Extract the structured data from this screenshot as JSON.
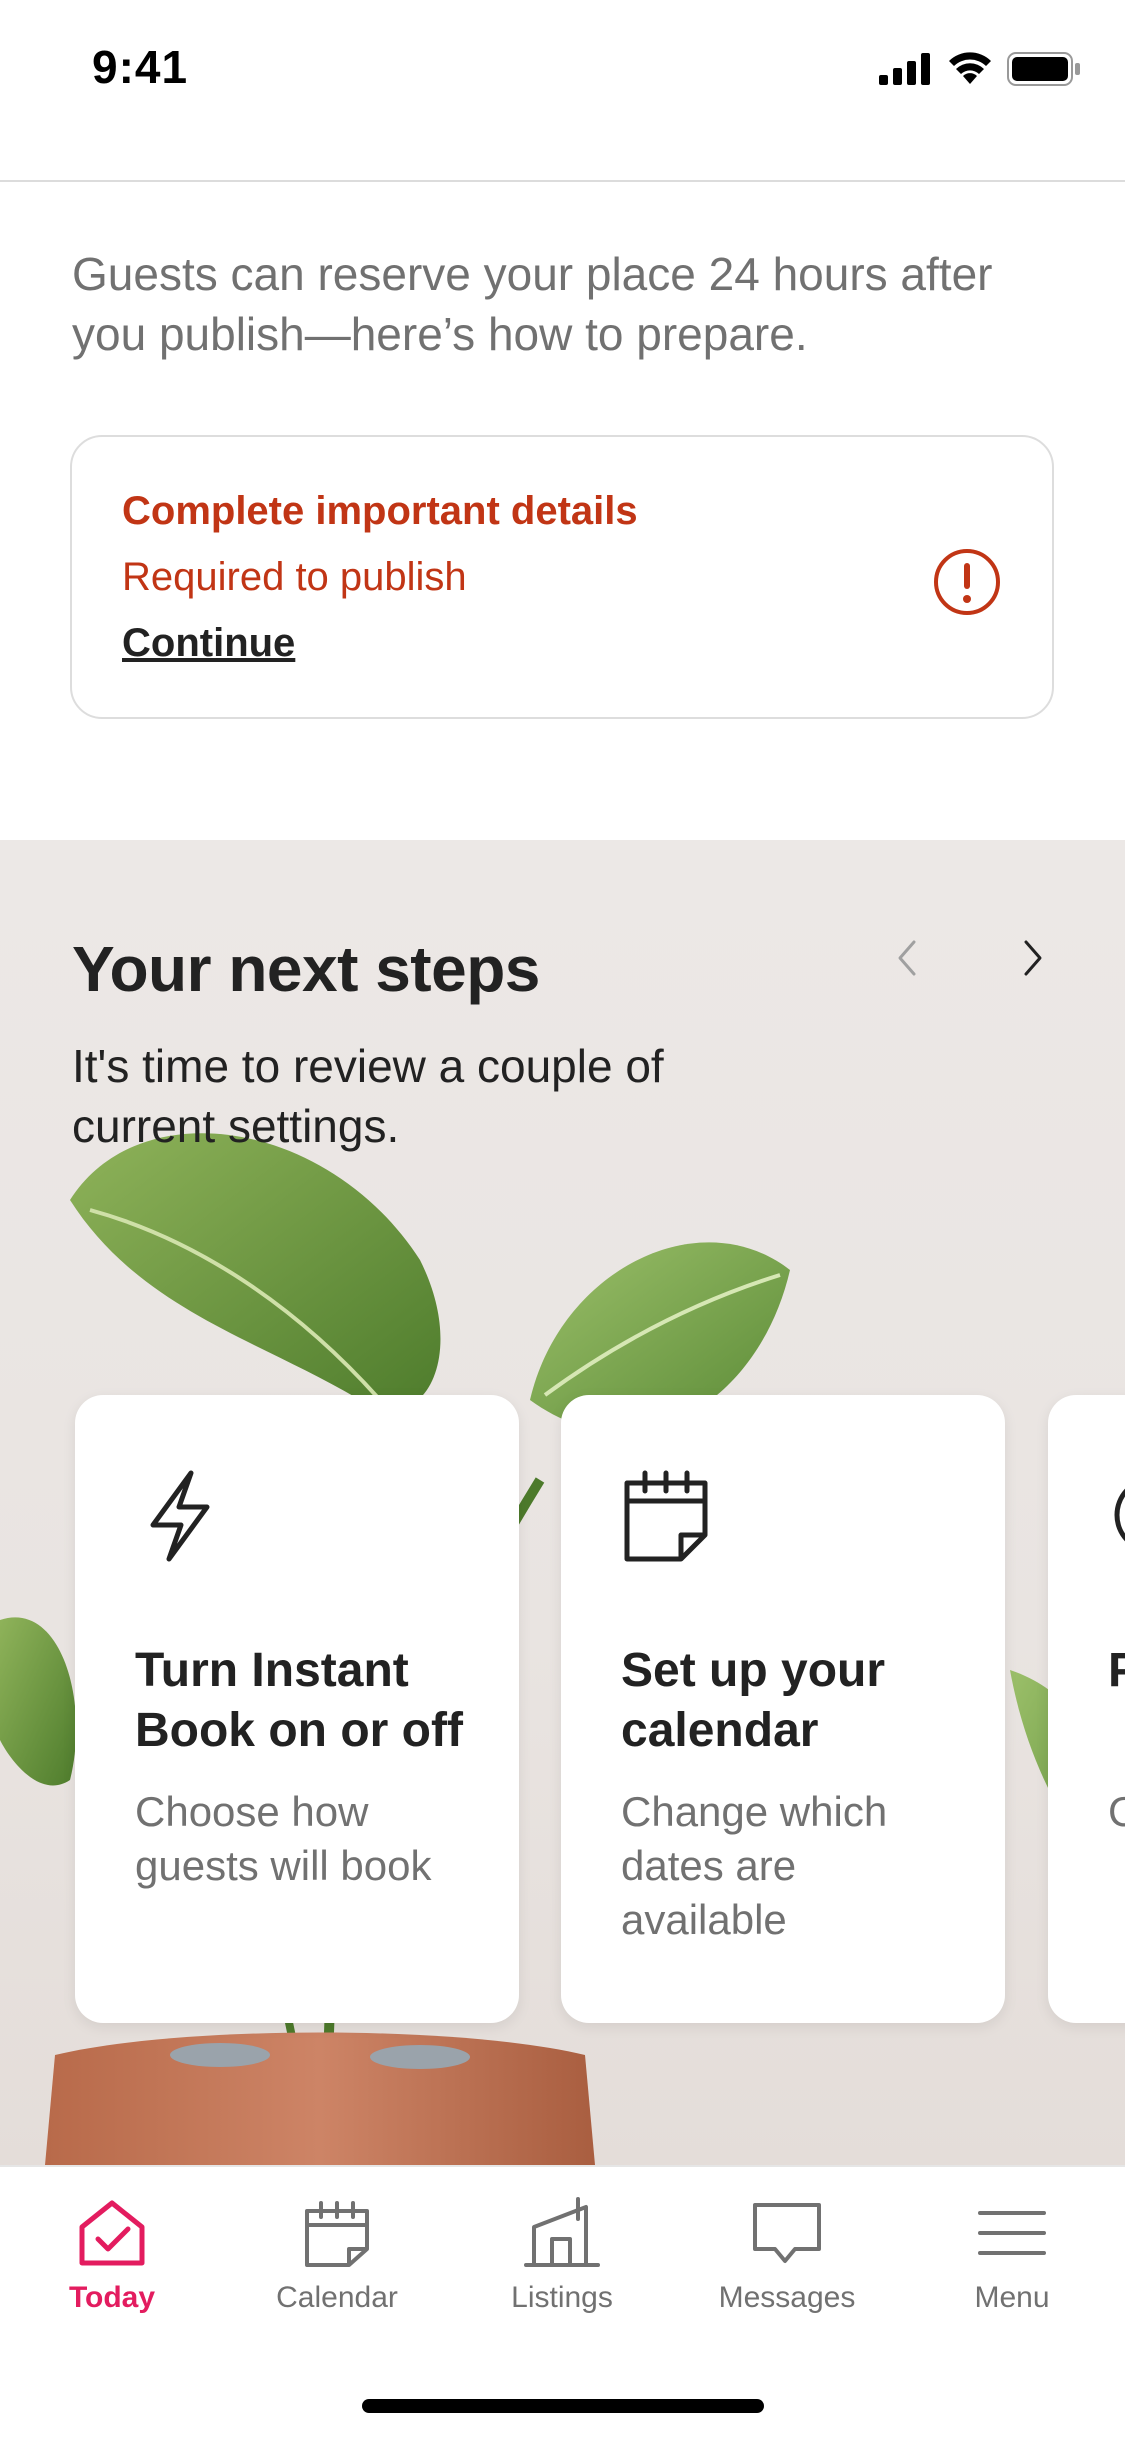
{
  "status_bar": {
    "time": "9:41"
  },
  "intro": {
    "text": "Guests can reserve your place 24 hours after you publish—here’s how to prepare."
  },
  "alert": {
    "title": "Complete important details",
    "subtitle": "Required to publish",
    "link": "Continue",
    "icon": "alert-circle-icon",
    "color": "#c13515"
  },
  "next_steps": {
    "title": "Your next steps",
    "subtitle": "It's time to review a couple of current settings.",
    "cards": [
      {
        "icon": "lightning-icon",
        "title": "Turn Instant Book on or off",
        "description": "Choose how guests will book"
      },
      {
        "icon": "calendar-icon",
        "title": "Set up your calendar",
        "description": "Change which dates are available"
      },
      {
        "icon": "partially-visible-icon",
        "title": "P p c",
        "description": "C r"
      }
    ]
  },
  "tab_bar": {
    "active_color": "#e31c5f",
    "tabs": [
      {
        "label": "Today",
        "icon": "home-check-icon",
        "active": true
      },
      {
        "label": "Calendar",
        "icon": "calendar-icon",
        "active": false
      },
      {
        "label": "Listings",
        "icon": "building-icon",
        "active": false
      },
      {
        "label": "Messages",
        "icon": "speech-bubble-icon",
        "active": false
      },
      {
        "label": "Menu",
        "icon": "hamburger-icon",
        "active": false
      }
    ]
  }
}
